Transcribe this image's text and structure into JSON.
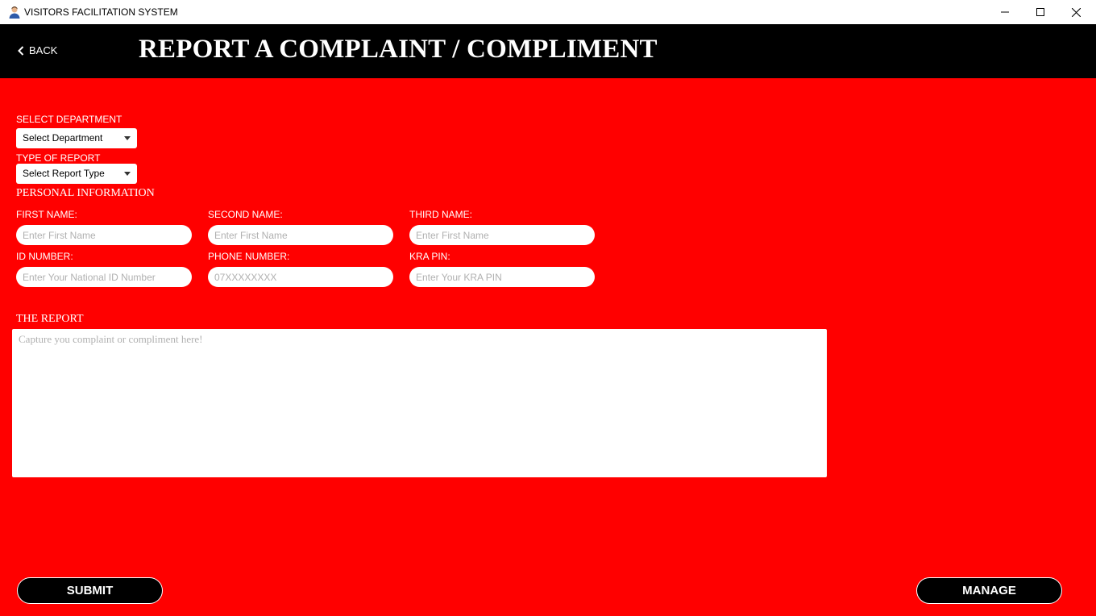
{
  "window": {
    "title": "VISITORS FACILITATION SYSTEM",
    "icon": "visitor-person-icon"
  },
  "header": {
    "back_label": "BACK",
    "title": "REPORT A COMPLAINT / COMPLIMENT",
    "background": "#000000"
  },
  "form": {
    "background": "#ff0000",
    "department": {
      "label": "SELECT DEPARTMENT",
      "value": "Select Department"
    },
    "report_type": {
      "label": "TYPE OF REPORT",
      "value": "Select Report Type"
    },
    "personal_section": "PERSONAL INFORMATION",
    "first_name": {
      "label": "FIRST NAME:",
      "placeholder": "Enter First Name"
    },
    "second_name": {
      "label": "SECOND NAME:",
      "placeholder": "Enter First Name"
    },
    "third_name": {
      "label": "THIRD NAME:",
      "placeholder": "Enter First Name"
    },
    "id_number": {
      "label": "ID NUMBER:",
      "placeholder": "Enter Your National ID Number"
    },
    "phone_number": {
      "label": "PHONE NUMBER:",
      "placeholder": "07XXXXXXXX"
    },
    "kra_pin": {
      "label": "KRA PIN:",
      "placeholder": "Enter Your KRA PIN"
    },
    "report_section": "THE REPORT",
    "report": {
      "placeholder": "Capture you complaint or compliment here!"
    }
  },
  "actions": {
    "submit_label": "SUBMIT",
    "manage_label": "MANAGE"
  }
}
